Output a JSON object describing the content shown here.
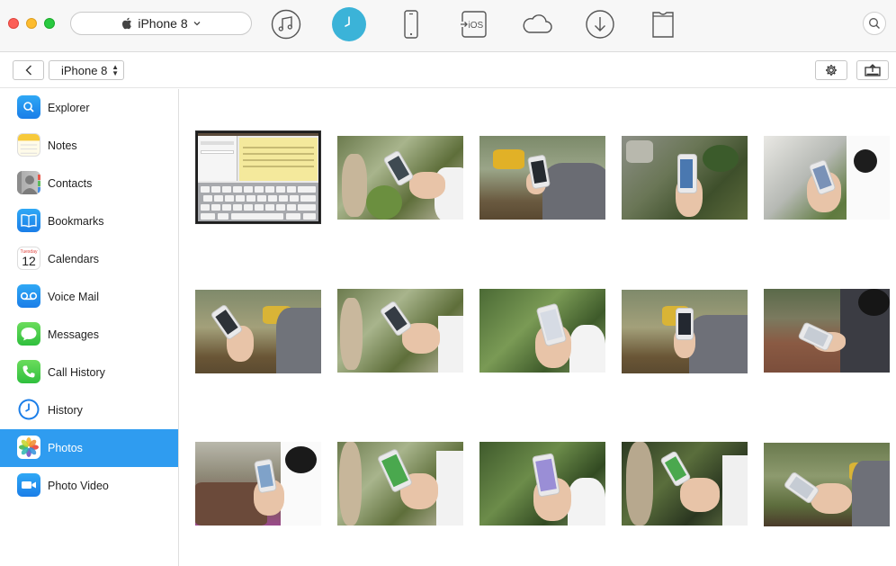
{
  "toolbar": {
    "device_name": "iPhone 8",
    "tools": [
      "music-icon",
      "history-clock-icon",
      "phone-icon",
      "to-ios-icon",
      "cloud-icon",
      "download-icon",
      "tshirt-icon"
    ],
    "ios_label": "iOS",
    "accent": "#3bb3d8"
  },
  "subbar": {
    "device_label": "iPhone 8"
  },
  "sidebar": {
    "items": [
      {
        "label": "Explorer",
        "icon": "explorer-icon"
      },
      {
        "label": "Notes",
        "icon": "notes-icon"
      },
      {
        "label": "Contacts",
        "icon": "contacts-icon"
      },
      {
        "label": "Bookmarks",
        "icon": "bookmarks-icon"
      },
      {
        "label": "Calendars",
        "icon": "calendar-icon",
        "icon_day": "Tuesday",
        "icon_date": "12"
      },
      {
        "label": "Voice Mail",
        "icon": "voicemail-icon"
      },
      {
        "label": "Messages",
        "icon": "messages-icon"
      },
      {
        "label": "Call History",
        "icon": "call-history-icon"
      },
      {
        "label": "History",
        "icon": "history-icon"
      },
      {
        "label": "Photos",
        "icon": "photos-icon",
        "selected": true
      },
      {
        "label": "Photo Video",
        "icon": "photo-video-icon"
      }
    ],
    "selected_color": "#2f9cf0"
  },
  "photos": {
    "count": 15
  }
}
